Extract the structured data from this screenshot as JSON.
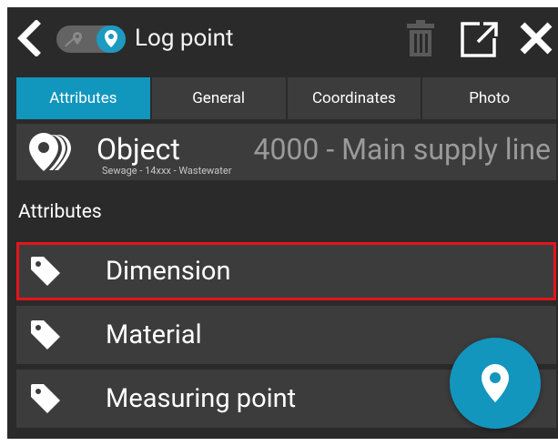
{
  "header": {
    "title": "Log point",
    "back_icon": "chevron-left-icon",
    "mode_toggle": {
      "left_icon": "route-pin-icon",
      "right_icon": "map-pin-icon",
      "state": "on"
    },
    "actions": [
      "trash-icon",
      "expand-icon",
      "close-icon"
    ]
  },
  "tabs": [
    {
      "label": "Attributes",
      "active": true
    },
    {
      "label": "General",
      "active": false
    },
    {
      "label": "Coordinates",
      "active": false
    },
    {
      "label": "Photo",
      "active": false
    }
  ],
  "object": {
    "label": "Object",
    "value": "4000 - Main supply line",
    "subtitle": "Sewage - 14xxx - Wastewater",
    "icon": "pipeline-icon"
  },
  "attributes": {
    "heading": "Attributes",
    "items": [
      {
        "label": "Dimension",
        "icon": "tag-icon",
        "highlighted": true
      },
      {
        "label": "Material",
        "icon": "tag-icon",
        "highlighted": false
      },
      {
        "label": "Measuring point",
        "icon": "tag-icon",
        "highlighted": false
      }
    ]
  },
  "fab": {
    "icon": "location-pin-icon"
  },
  "colors": {
    "background": "#2a2a2a",
    "panel": "#3c3c3c",
    "accent": "#1196be",
    "highlight": "#e5131b",
    "text": "#ffffff",
    "muted_text": "#9a9a9a"
  }
}
